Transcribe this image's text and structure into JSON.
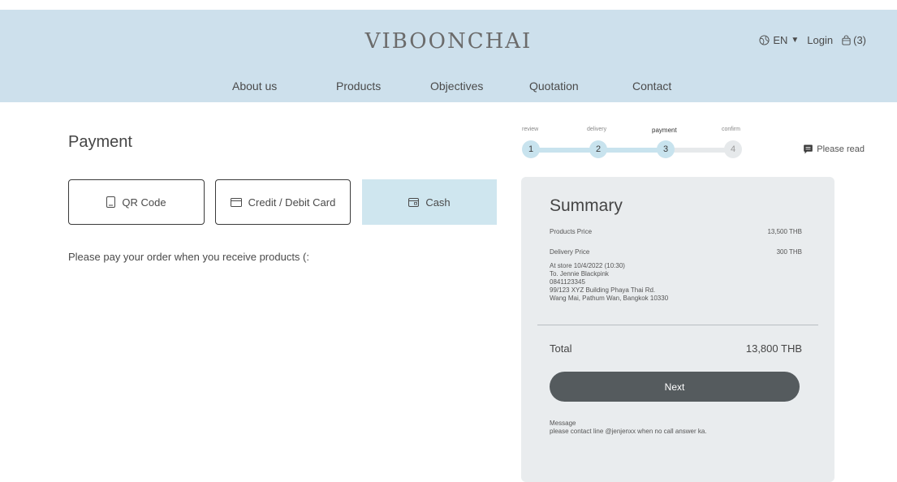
{
  "brand": "VIBOONCHAI",
  "top_bar": {
    "language": "EN",
    "login": "Login",
    "cart_count": "(3)"
  },
  "nav": [
    "About us",
    "Products",
    "Objectives",
    "Quotation",
    "Contact"
  ],
  "page_title": "Payment",
  "payment_methods": [
    {
      "label": "QR Code",
      "icon": "qr-icon",
      "selected": false
    },
    {
      "label": "Credit / Debit Card",
      "icon": "card-icon",
      "selected": false
    },
    {
      "label": "Cash",
      "icon": "cash-icon",
      "selected": true
    }
  ],
  "payment_note": "Please pay your order when you receive products (:",
  "stepper": {
    "steps": [
      {
        "label": "review",
        "number": "1"
      },
      {
        "label": "delivery",
        "number": "2"
      },
      {
        "label": "payment",
        "number": "3"
      },
      {
        "label": "confirm",
        "number": "4"
      }
    ],
    "current_step": 3
  },
  "please_read": "Please read",
  "summary": {
    "title": "Summary",
    "products_label": "Products Price",
    "products_value": "13,500 THB",
    "delivery_label": "Delivery Price",
    "delivery_value": "300 THB",
    "delivery_details": [
      "At store 10/4/2022 (10:30)",
      "To. Jennie Blackpink",
      "0841123345",
      "99/123 XYZ Building Phaya Thai Rd.",
      "Wang Mai, Pathum Wan, Bangkok 10330"
    ],
    "total_label": "Total",
    "total_value": "13,800 THB",
    "next_label": "Next",
    "message_label": "Message",
    "message_text": "please contact line @jenjenxx when no call answer ka."
  },
  "colors": {
    "header_bg": "#cde0ec",
    "accent": "#c8e3ee",
    "summary_bg": "#e9ecee",
    "button": "#555b5e"
  }
}
